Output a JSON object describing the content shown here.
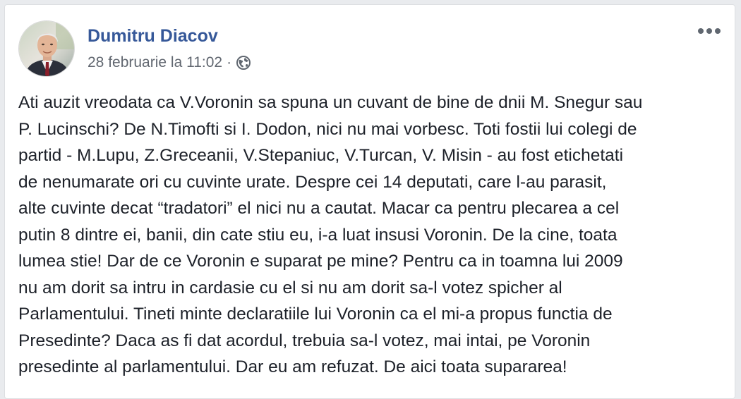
{
  "post": {
    "author": {
      "name": "Dumitru Diacov"
    },
    "timestamp": "28 februarie la 11:02",
    "separator": "·",
    "privacy_icon": "globe-icon",
    "more_icon": "more-options-icon",
    "text_lines": [
      "Ati auzit vreodata ca V.Voronin sa spuna un cuvant de bine de dnii M. Snegur sau",
      "P. Lucinschi? De N.Timofti si I. Dodon, nici nu mai vorbesc. Toti fostii lui colegi de",
      "partid - M.Lupu, Z.Greceanii, V.Stepaniuc, V.Turcan, V. Misin - au fost etichetati",
      "de nenumarate ori cu cuvinte urate. Despre cei 14 deputati, care l-au parasit,",
      "alte cuvinte decat “tradatori” el nici nu a cautat. Macar ca pentru plecarea a cel",
      "putin 8 dintre ei, banii, din cate stiu eu, i-a luat insusi Voronin. De la cine, toata",
      "lumea stie! Dar de ce Voronin e suparat pe mine? Pentru ca in toamna lui 2009",
      "nu am dorit sa intru in cardasie cu el si nu am dorit sa-l votez spicher al",
      "Parlamentului. Tineti minte declaratiile lui Voronin ca el mi-a propus functia de",
      "Presedinte? Daca as fi dat acordul, trebuia sa-l votez, mai intai, pe Voronin",
      "presedinte al parlamentului. Dar eu am refuzat. De aici toata supararea!"
    ]
  },
  "colors": {
    "author_link": "#365899",
    "meta_text": "#616770",
    "body_text": "#1d2129",
    "page_bg": "#e9ebee",
    "card_bg": "#ffffff"
  }
}
